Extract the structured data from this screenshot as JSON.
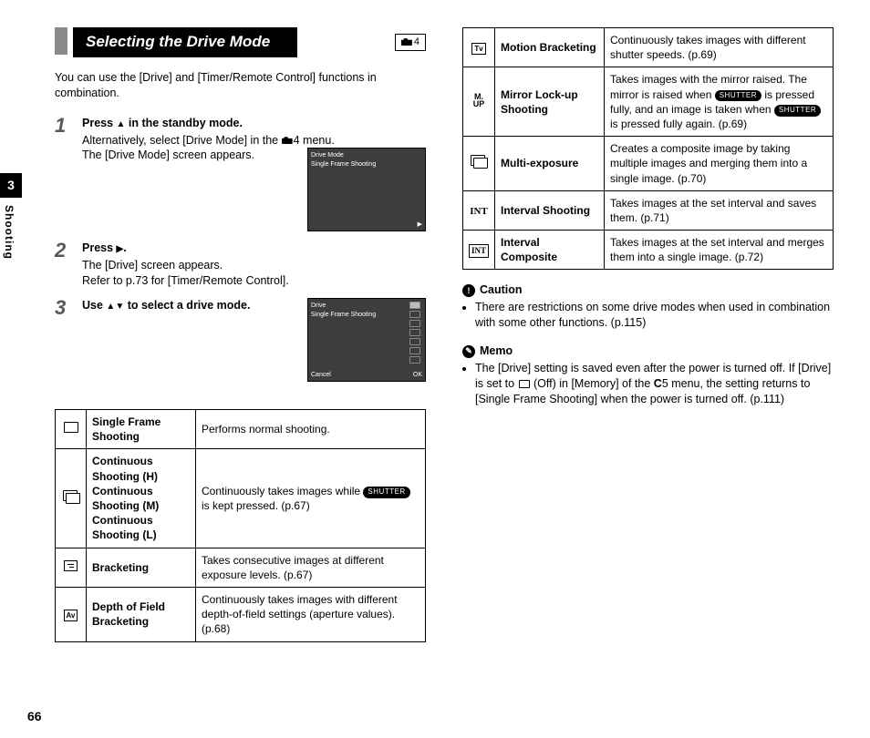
{
  "meta": {
    "page_number": "66",
    "chapter_num": "3",
    "chapter_name": "Shooting"
  },
  "header": {
    "title": "Selecting the Drive Mode",
    "badge_num": "4"
  },
  "intro": "You can use the [Drive] and [Timer/Remote Control] functions in combination.",
  "steps": {
    "s1": {
      "num": "1",
      "head_a": "Press ",
      "head_b": " in the standby mode.",
      "sub_a": "Alternatively, select [Drive Mode] in the ",
      "sub_b": "4 menu.",
      "sub_c": "The [Drive Mode] screen appears."
    },
    "s2": {
      "num": "2",
      "head_a": "Press ",
      "head_b": ".",
      "sub_a": "The [Drive] screen appears.",
      "sub_b": "Refer to p.73 for [Timer/Remote Control]."
    },
    "s3": {
      "num": "3",
      "head_a": "Use ",
      "head_b": " to select a drive mode."
    }
  },
  "screen1": {
    "title": "Drive Mode",
    "line": "Single Frame Shooting"
  },
  "screen2": {
    "title": "Drive",
    "line": "Single Frame Shooting",
    "cancel": "Cancel",
    "ok": "OK"
  },
  "shutter_label": "SHUTTER",
  "modes": [
    {
      "icon": "single",
      "name": "Single Frame Shooting",
      "desc": "Performs normal shooting."
    },
    {
      "icon": "cont",
      "name": "Continuous Shooting (H)\nContinuous Shooting (M)\nContinuous Shooting (L)",
      "desc_a": "Continuously takes images while ",
      "desc_b": " is kept pressed. (p.67)"
    },
    {
      "icon": "brk",
      "name": "Bracketing",
      "desc": "Takes consecutive images at different exposure levels. (p.67)"
    },
    {
      "icon": "av",
      "name": "Depth of Field Bracketing",
      "desc": "Continuously takes images with different depth-of-field settings (aperture values). (p.68)"
    },
    {
      "icon": "tv",
      "name": "Motion Bracketing",
      "desc": "Continuously takes images with different shutter speeds. (p.69)"
    },
    {
      "icon": "mup",
      "name": "Mirror Lock-up Shooting",
      "desc_a": "Takes images with the mirror raised. The mirror is raised when ",
      "desc_b": " is pressed fully, and an image is taken when ",
      "desc_c": " is pressed fully again. (p.69)"
    },
    {
      "icon": "multi",
      "name": "Multi-exposure",
      "desc": "Creates a composite image by taking multiple images and merging them into a single image. (p.70)"
    },
    {
      "icon": "int",
      "name": "Interval Shooting",
      "desc": "Takes images at the set interval and saves them. (p.71)"
    },
    {
      "icon": "intc",
      "name": "Interval Composite",
      "desc": "Takes images at the set interval and merges them into a single image. (p.72)"
    }
  ],
  "caution": {
    "head": "Caution",
    "items": [
      "There are restrictions on some drive modes when used in combination with some other functions. (p.115)"
    ]
  },
  "memo": {
    "head": "Memo",
    "item_a": "The [Drive] setting is saved even after the power is turned off. If [Drive] is set to ",
    "item_b": " (Off) in [Memory] of the ",
    "item_c": "5 menu, the setting returns to [Single Frame Shooting] when the power is turned off. (p.111)",
    "csym": "C"
  }
}
